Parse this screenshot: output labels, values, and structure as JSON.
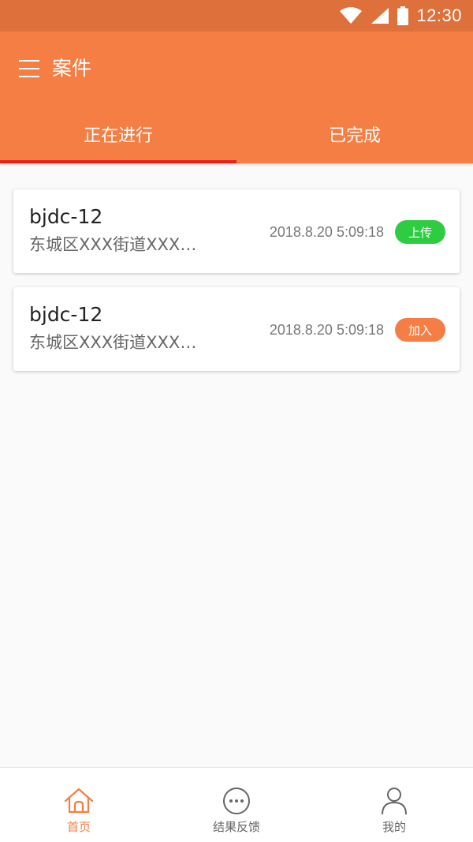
{
  "status_bar": {
    "time": "12:30"
  },
  "app_bar": {
    "title": "案件"
  },
  "tabs": [
    {
      "label": "正在进行",
      "active": true
    },
    {
      "label": "已完成",
      "active": false
    }
  ],
  "cases": [
    {
      "id": "bjdc-12",
      "address": "东城区XXX街道XXX…",
      "time": "2018.8.20 5:09:18",
      "action": "上传",
      "action_color": "#2ecc40"
    },
    {
      "id": "bjdc-12",
      "address": "东城区XXX街道XXX…",
      "time": "2018.8.20 5:09:18",
      "action": "加入",
      "action_color": "#f47e44"
    }
  ],
  "bottom_nav": [
    {
      "label": "首页",
      "icon": "home-icon",
      "active": true
    },
    {
      "label": "结果反馈",
      "icon": "chat-bubble-icon",
      "active": false
    },
    {
      "label": "我的",
      "icon": "user-icon",
      "active": false
    }
  ],
  "colors": {
    "primary": "#f47e44",
    "status_bar": "#de703b",
    "tab_indicator": "#e8211c"
  }
}
